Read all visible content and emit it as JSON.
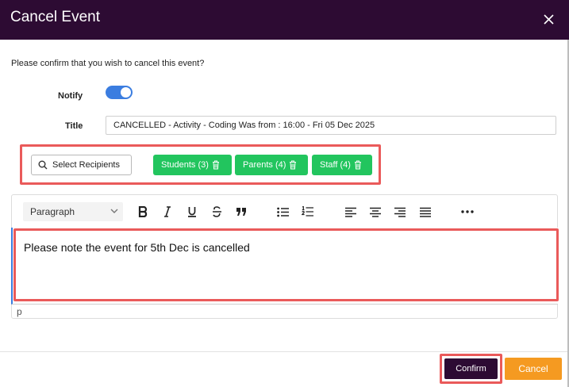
{
  "dialog": {
    "title": "Cancel Event",
    "prompt": "Please confirm that you wish to cancel this event?"
  },
  "form": {
    "notify_label": "Notify",
    "notify_on": true,
    "title_label": "Title",
    "title_value": "CANCELLED - Activity - Coding Was from : 16:00 - Fri 05 Dec 2025"
  },
  "recipients": {
    "select_label": "Select Recipients",
    "groups": [
      {
        "label": "Students (3)"
      },
      {
        "label": "Parents (4)"
      },
      {
        "label": "Staff (4)"
      }
    ]
  },
  "editor": {
    "block_format": "Paragraph",
    "toolbar_icons": [
      "bold-icon",
      "italic-icon",
      "underline-icon",
      "strikethrough-icon",
      "blockquote-icon",
      "bullet-list-icon",
      "numbered-list-icon",
      "align-left-icon",
      "align-center-icon",
      "align-right-icon",
      "align-justify-icon",
      "more-icon"
    ],
    "content": "Please note the event for 5th Dec is cancelled",
    "status_path": "p"
  },
  "footer": {
    "confirm_label": "Confirm",
    "cancel_label": "Cancel"
  },
  "colors": {
    "header": "#2d0b33",
    "toggle": "#3b7de0",
    "group_button": "#22c55e",
    "highlight": "#ea5a5a",
    "cancel": "#f59a21"
  }
}
